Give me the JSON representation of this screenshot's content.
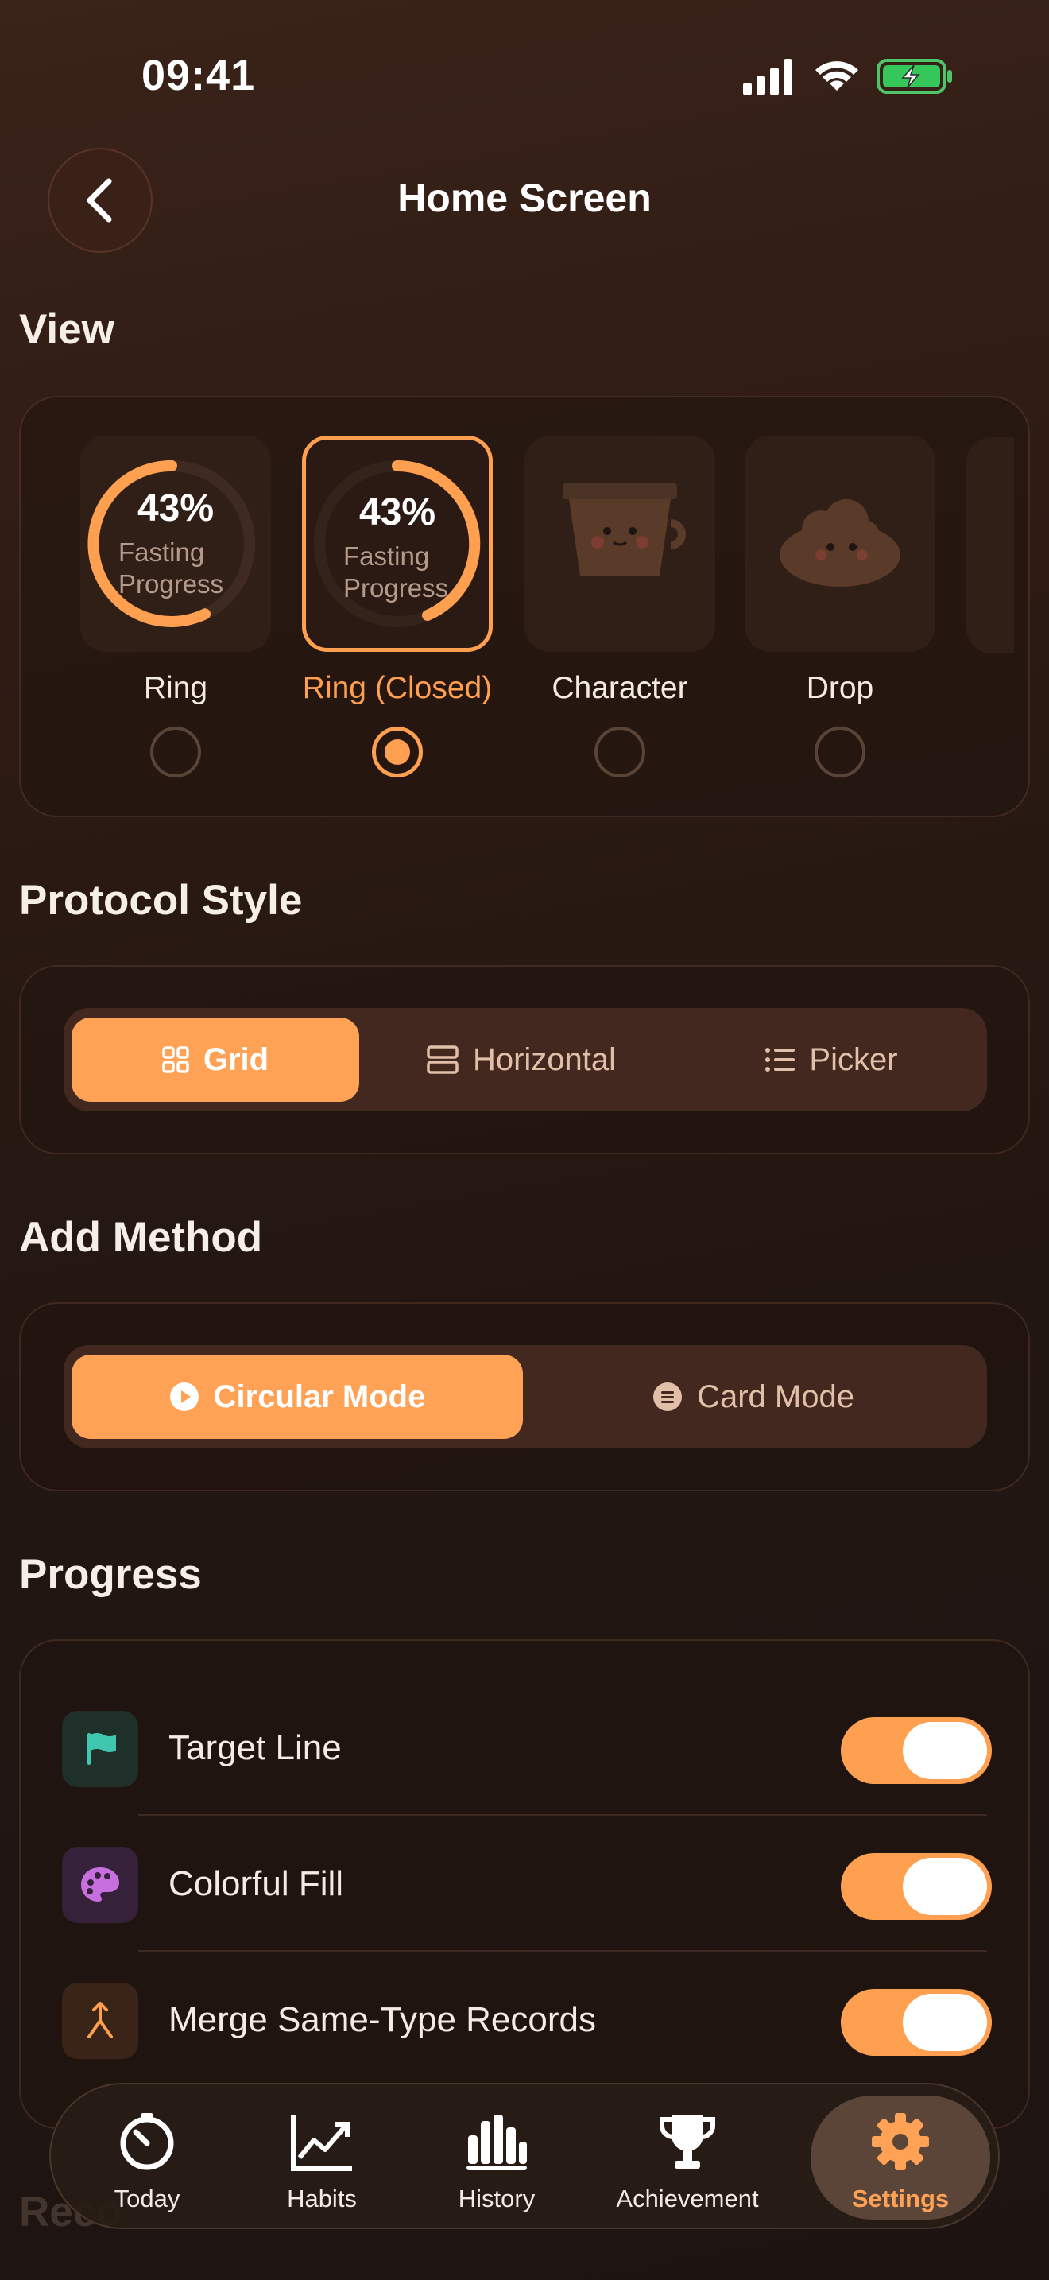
{
  "status": {
    "time": "09:41"
  },
  "header": {
    "title": "Home Screen"
  },
  "view": {
    "title": "View",
    "options": [
      {
        "label": "Ring",
        "percent": "43%",
        "caption1": "Fasting",
        "caption2": "Progress",
        "selected": false
      },
      {
        "label": "Ring (Closed)",
        "percent": "43%",
        "caption1": "Fasting",
        "caption2": "Progress",
        "selected": true
      },
      {
        "label": "Character",
        "selected": false
      },
      {
        "label": "Drop",
        "selected": false
      }
    ]
  },
  "protocol_style": {
    "title": "Protocol Style",
    "options": [
      "Grid",
      "Horizontal",
      "Picker"
    ],
    "selected": "Grid"
  },
  "add_method": {
    "title": "Add Method",
    "options": [
      "Circular Mode",
      "Card Mode"
    ],
    "selected": "Circular Mode"
  },
  "progress": {
    "title": "Progress",
    "items": [
      {
        "label": "Target Line",
        "icon": "flag-icon",
        "enabled": true
      },
      {
        "label": "Colorful Fill",
        "icon": "palette-icon",
        "enabled": true
      },
      {
        "label": "Merge Same-Type Records",
        "icon": "merge-icon",
        "enabled": true
      }
    ]
  },
  "next_section_peek": "Reco",
  "tabbar": {
    "items": [
      {
        "label": "Today",
        "icon": "timer-icon"
      },
      {
        "label": "Habits",
        "icon": "trend-chart-icon"
      },
      {
        "label": "History",
        "icon": "bar-chart-icon"
      },
      {
        "label": "Achievement",
        "icon": "trophy-icon"
      },
      {
        "label": "Settings",
        "icon": "gear-icon",
        "active": true
      }
    ]
  },
  "colors": {
    "accent": "#ff9f50",
    "background": "#2a1a13"
  }
}
